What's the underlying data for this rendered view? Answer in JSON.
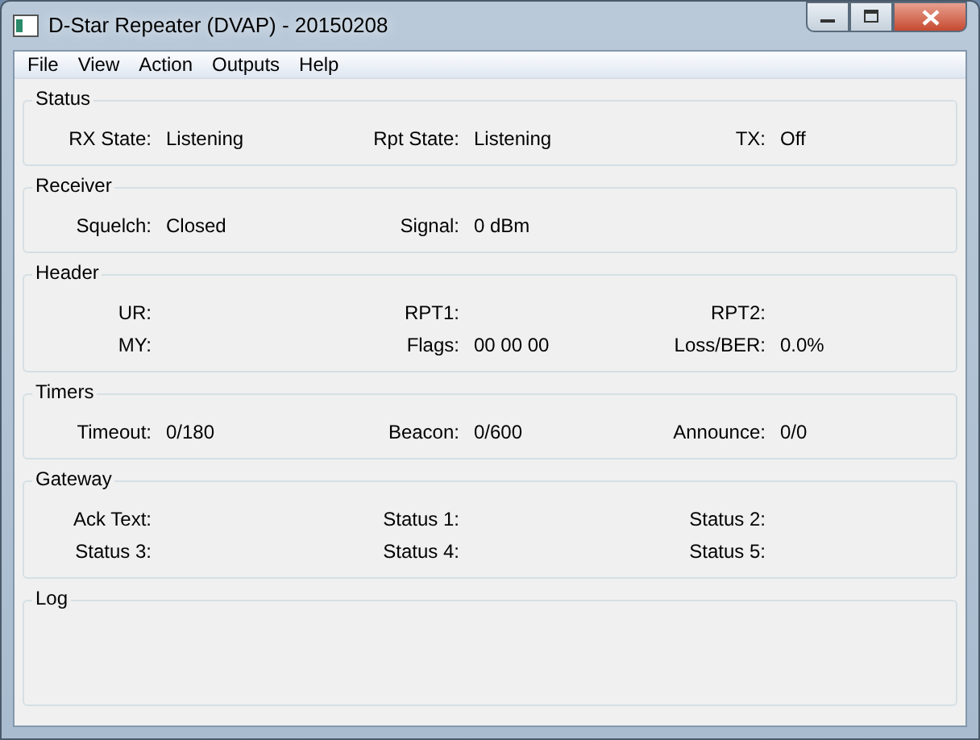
{
  "window": {
    "title": "D-Star Repeater (DVAP) - 20150208"
  },
  "menu": [
    "File",
    "View",
    "Action",
    "Outputs",
    "Help"
  ],
  "groups": [
    {
      "title": "Status",
      "rows": [
        [
          {
            "label": "RX State:",
            "value": "Listening"
          },
          {
            "label": "Rpt State:",
            "value": "Listening"
          },
          {
            "label": "TX:",
            "value": "Off"
          }
        ]
      ]
    },
    {
      "title": "Receiver",
      "rows": [
        [
          {
            "label": "Squelch:",
            "value": "Closed"
          },
          {
            "label": "Signal:",
            "value": "0 dBm"
          }
        ]
      ]
    },
    {
      "title": "Header",
      "rows": [
        [
          {
            "label": "UR:"
          },
          {
            "label": "RPT1:"
          },
          {
            "label": "RPT2:"
          }
        ],
        [
          {
            "label": "MY:"
          },
          {
            "label": "Flags:",
            "value": "00 00 00"
          },
          {
            "label": "Loss/BER:",
            "value": "0.0%"
          }
        ]
      ]
    },
    {
      "title": "Timers",
      "rows": [
        [
          {
            "label": "Timeout:",
            "value": "0/180"
          },
          {
            "label": "Beacon:",
            "value": "0/600"
          },
          {
            "label": "Announce:",
            "value": "0/0"
          }
        ]
      ]
    },
    {
      "title": "Gateway",
      "rows": [
        [
          {
            "label": "Ack Text:"
          },
          {
            "label": "Status 1:"
          },
          {
            "label": "Status 2:"
          }
        ],
        [
          {
            "label": "Status 3:"
          },
          {
            "label": "Status 4:"
          },
          {
            "label": "Status 5:"
          }
        ]
      ]
    },
    {
      "title": "Log",
      "kind": "log"
    }
  ]
}
